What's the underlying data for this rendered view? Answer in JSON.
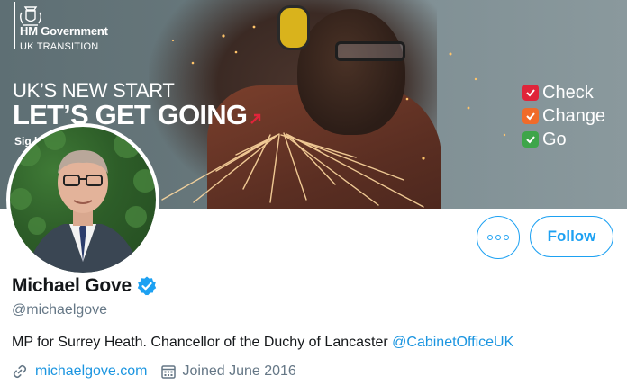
{
  "banner": {
    "gov_name": "HM Government",
    "gov_sub": "UK TRANSITION",
    "headline_line1": "UK’S NEW START",
    "headline_line2": "LET’S GET GOING",
    "sign_text": "Sig                                   k/transition",
    "checklist": [
      {
        "label": "Check",
        "color": "#e0243a",
        "icon": "check-icon"
      },
      {
        "label": "Change",
        "color": "#f06b2a",
        "icon": "check-icon"
      },
      {
        "label": "Go",
        "color": "#3ea54a",
        "icon": "check-icon"
      }
    ]
  },
  "profile": {
    "display_name": "Michael Gove",
    "handle": "@michaelgove",
    "bio_text": "MP for Surrey Heath. Chancellor of the Duchy of Lancaster ",
    "bio_mention": "@CabinetOfficeUK",
    "website": "michaelgove.com",
    "joined": "Joined June 2016",
    "verified": true
  },
  "actions": {
    "follow_label": "Follow",
    "more_icon": "more-options-icon"
  },
  "colors": {
    "accent": "#1da1f2",
    "link": "#1b95e0",
    "secondary_text": "#657786"
  }
}
